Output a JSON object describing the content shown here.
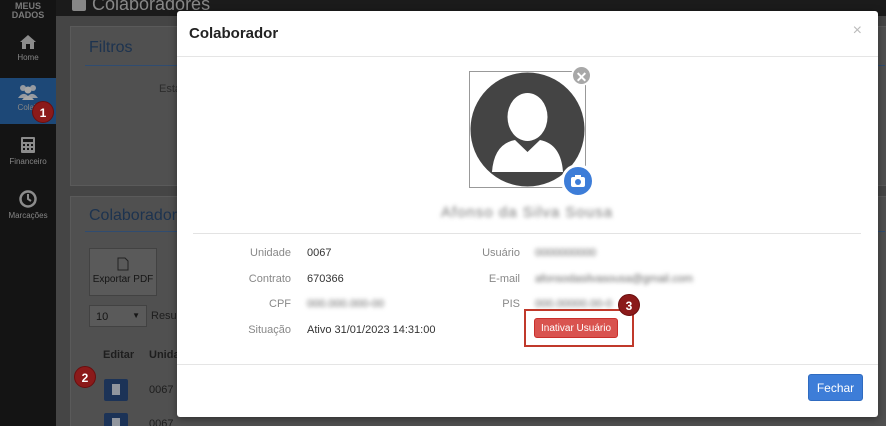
{
  "sidebar": {
    "brand_line1": "MEUS",
    "brand_line2": "DADOS",
    "items": [
      {
        "label": "Home",
        "icon": "home-icon"
      },
      {
        "label": "Colab",
        "icon": "users-icon"
      },
      {
        "label": "Financeiro",
        "icon": "calculator-icon"
      },
      {
        "label": "Marcações",
        "icon": "clock-icon"
      }
    ]
  },
  "background": {
    "page_title": "Colaboradores",
    "filters_title": "Filtros",
    "filter_label": "Esta",
    "list_title": "Colaborador",
    "export_label": "Exportar PDF",
    "page_size": "10",
    "results_label": "Resul",
    "col_edit": "Editar",
    "col_unit": "Unida",
    "row1_unit": "0067",
    "row2_unit": "0067"
  },
  "modal": {
    "title": "Colaborador",
    "close_symbol": "×",
    "user_name": "Afonso da Silva Sousa",
    "fields_left": [
      {
        "label": "Unidade",
        "value": "0067"
      },
      {
        "label": "Contrato",
        "value": "670366"
      },
      {
        "label": "CPF",
        "value": "000.000.000-00"
      },
      {
        "label": "Situação",
        "value": "Ativo 31/01/2023 14:31:00"
      }
    ],
    "fields_right": [
      {
        "label": "Usuário",
        "value": "0000000000"
      },
      {
        "label": "E-mail",
        "value": "afonsodasilvasousa@gmail.com"
      },
      {
        "label": "PIS",
        "value": "000.00000.00-0"
      }
    ],
    "inactivate_label": "Inativar Usuário",
    "close_button_label": "Fechar"
  },
  "annotations": {
    "step1": "1",
    "step2": "2",
    "step3": "3"
  },
  "colors": {
    "accent": "#3d7dd8",
    "danger": "#d9534f",
    "badge": "#8b1a1a"
  }
}
